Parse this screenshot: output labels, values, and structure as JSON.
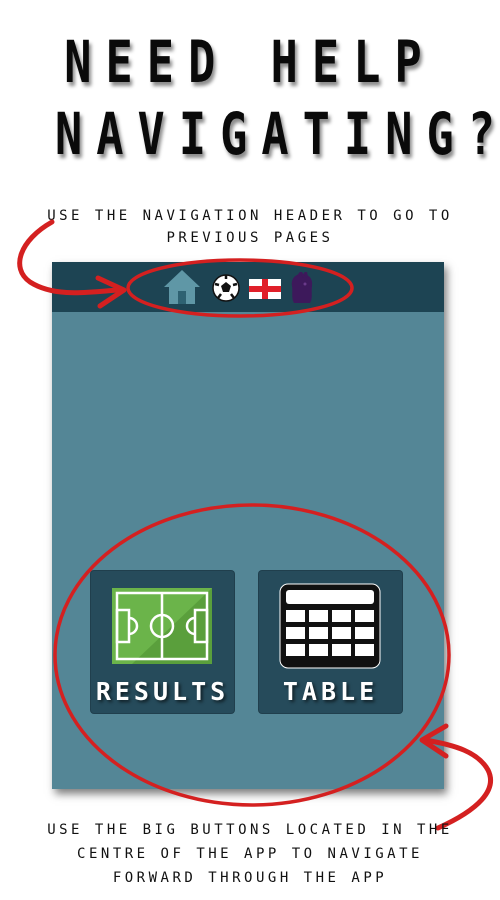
{
  "headline": {
    "line1": "NEED HELP",
    "line2": "NAVIGATING?"
  },
  "captions": {
    "top": [
      "USE THE NAVIGATION HEADER TO GO TO",
      "PREVIOUS PAGES"
    ],
    "bottom": [
      "USE THE BIG BUTTONS LOCATED IN THE",
      "CENTRE OF THE APP TO NAVIGATE",
      "FORWARD THROUGH THE APP"
    ]
  },
  "app": {
    "header_icons": [
      "home-icon",
      "football-icon",
      "england-flag-icon",
      "premier-league-lion-icon"
    ],
    "buttons": [
      {
        "label": "RESULTS",
        "icon": "football-pitch-icon"
      },
      {
        "label": "TABLE",
        "icon": "league-table-icon"
      }
    ]
  },
  "colors": {
    "app_background": "#548696",
    "header_background": "#1d4453",
    "button_background": "#264b5b",
    "highlight_red": "#d42020"
  }
}
